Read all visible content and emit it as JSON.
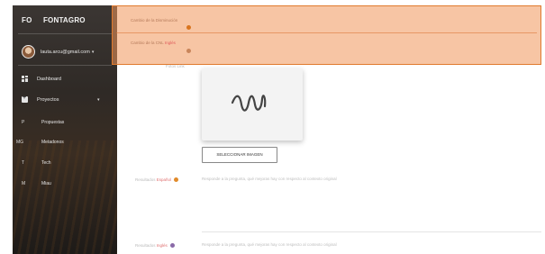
{
  "sidebar": {
    "brand_abbr": "FO",
    "brand_name": "FONTAGRO",
    "user_email": "lauta.arcu@gmail.com",
    "user_caret": "▾",
    "items": [
      {
        "label": "Dashboard",
        "icon": "dashboard-icon"
      },
      {
        "label": "Proyectos",
        "icon": "plus-box-icon",
        "caret": "▾"
      }
    ],
    "subitems": [
      {
        "abbr": "P",
        "label": "Propuestas"
      },
      {
        "abbr": "MG",
        "label": "Metadonos"
      },
      {
        "abbr": "T",
        "label": "Tech"
      },
      {
        "abbr": "M",
        "label": "Miau"
      }
    ]
  },
  "form": {
    "field1_label": "Cambio de la Disminución",
    "field2_label": "Cambio de la CNL",
    "field2_lang": "Inglés",
    "photo_label": "Fotos Link",
    "select_image_button": "SELECCIONAR IMAGEN",
    "result_es_label": "Resultados",
    "result_es_lang": "Español",
    "result_es_placeholder": "Responde a la pregunta, qué mejoras hay con respecto al contexto original",
    "result_en_label": "Resultados",
    "result_en_lang": "Inglés",
    "result_en_placeholder": "Responde a la pregunta, qué mejoras hay con respecto al contexto original"
  },
  "colors": {
    "overlay": "#f0965a",
    "accent_dot": "#d9751f",
    "sidebar_bg": "#2f2a26"
  }
}
